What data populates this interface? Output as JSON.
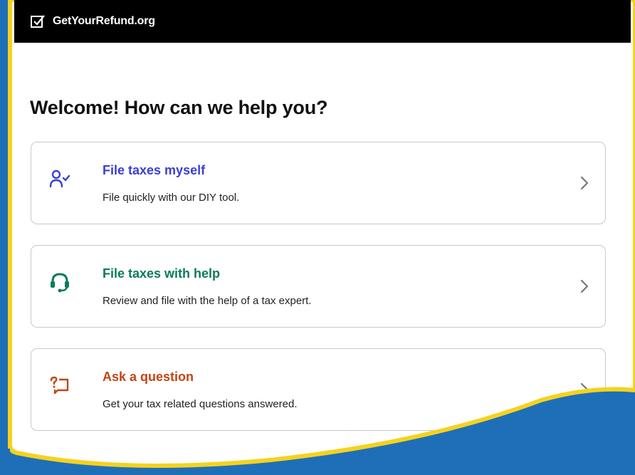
{
  "header": {
    "brand": "GetYourRefund.org",
    "brand_icon": "checkbox-check-icon"
  },
  "page": {
    "heading": "Welcome! How can we help you?"
  },
  "options": [
    {
      "title": "File taxes myself",
      "description": "File quickly with our DIY tool.",
      "icon": "person-check-icon",
      "color": "#3b3fd1"
    },
    {
      "title": "File taxes with help",
      "description": "Review and file with the help of a tax expert.",
      "icon": "headset-icon",
      "color": "#0d7a5c"
    },
    {
      "title": "Ask a question",
      "description": "Get your tax related questions answered.",
      "icon": "question-chat-icon",
      "color": "#c4440f"
    }
  ],
  "colors": {
    "background": "#1f6fb8",
    "frame_border": "#f5d21f",
    "topbar": "#000000"
  }
}
